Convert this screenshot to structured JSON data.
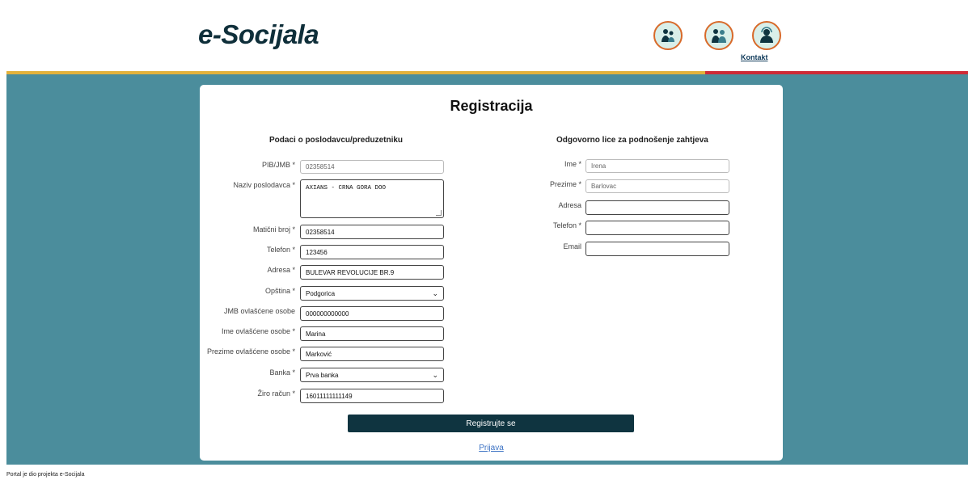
{
  "header": {
    "logo": "e-Socijala",
    "contact_label": "Kontakt"
  },
  "page": {
    "title": "Registracija"
  },
  "employer": {
    "heading": "Podaci o poslodavcu/preduzetniku",
    "fields": [
      {
        "label": "PIB/JMB *",
        "value": "02358514"
      },
      {
        "label": "Naziv poslodavca *",
        "value": "AXIANS - CRNA GORA DOO"
      },
      {
        "label": "Matični broj *",
        "value": "02358514"
      },
      {
        "label": "Telefon *",
        "value": "123456"
      },
      {
        "label": "Adresa *",
        "value": "BULEVAR REVOLUCIJE BR.9"
      },
      {
        "label": "Opština *",
        "value": "Podgorica"
      },
      {
        "label": "JMB ovlašćene osobe",
        "value": "000000000000"
      },
      {
        "label": "Ime ovlašćene osobe *",
        "value": "Marina"
      },
      {
        "label": "Prezime ovlašćene osobe *",
        "value": "Marković"
      },
      {
        "label": "Banka *",
        "value": "Prva banka"
      },
      {
        "label": "Žiro račun *",
        "value": "16011111111149"
      }
    ]
  },
  "responsible": {
    "heading": "Odgovorno lice za podnošenje zahtjeva",
    "fields": [
      {
        "label": "Ime *",
        "value": "Irena"
      },
      {
        "label": "Prezime *",
        "value": "Barlovac"
      },
      {
        "label": "Adresa",
        "value": ""
      },
      {
        "label": "Telefon *",
        "value": ""
      },
      {
        "label": "Email",
        "value": ""
      }
    ]
  },
  "actions": {
    "register_label": "Registrujte se",
    "login_link": "Prijava"
  },
  "footer": {
    "text": "Portal je dio projekta e-Socijala"
  },
  "colors": {
    "background": "#4b8d9c",
    "button": "#0f3440",
    "stripe_yellow": "#e3b23c",
    "stripe_red": "#cf2b36"
  }
}
